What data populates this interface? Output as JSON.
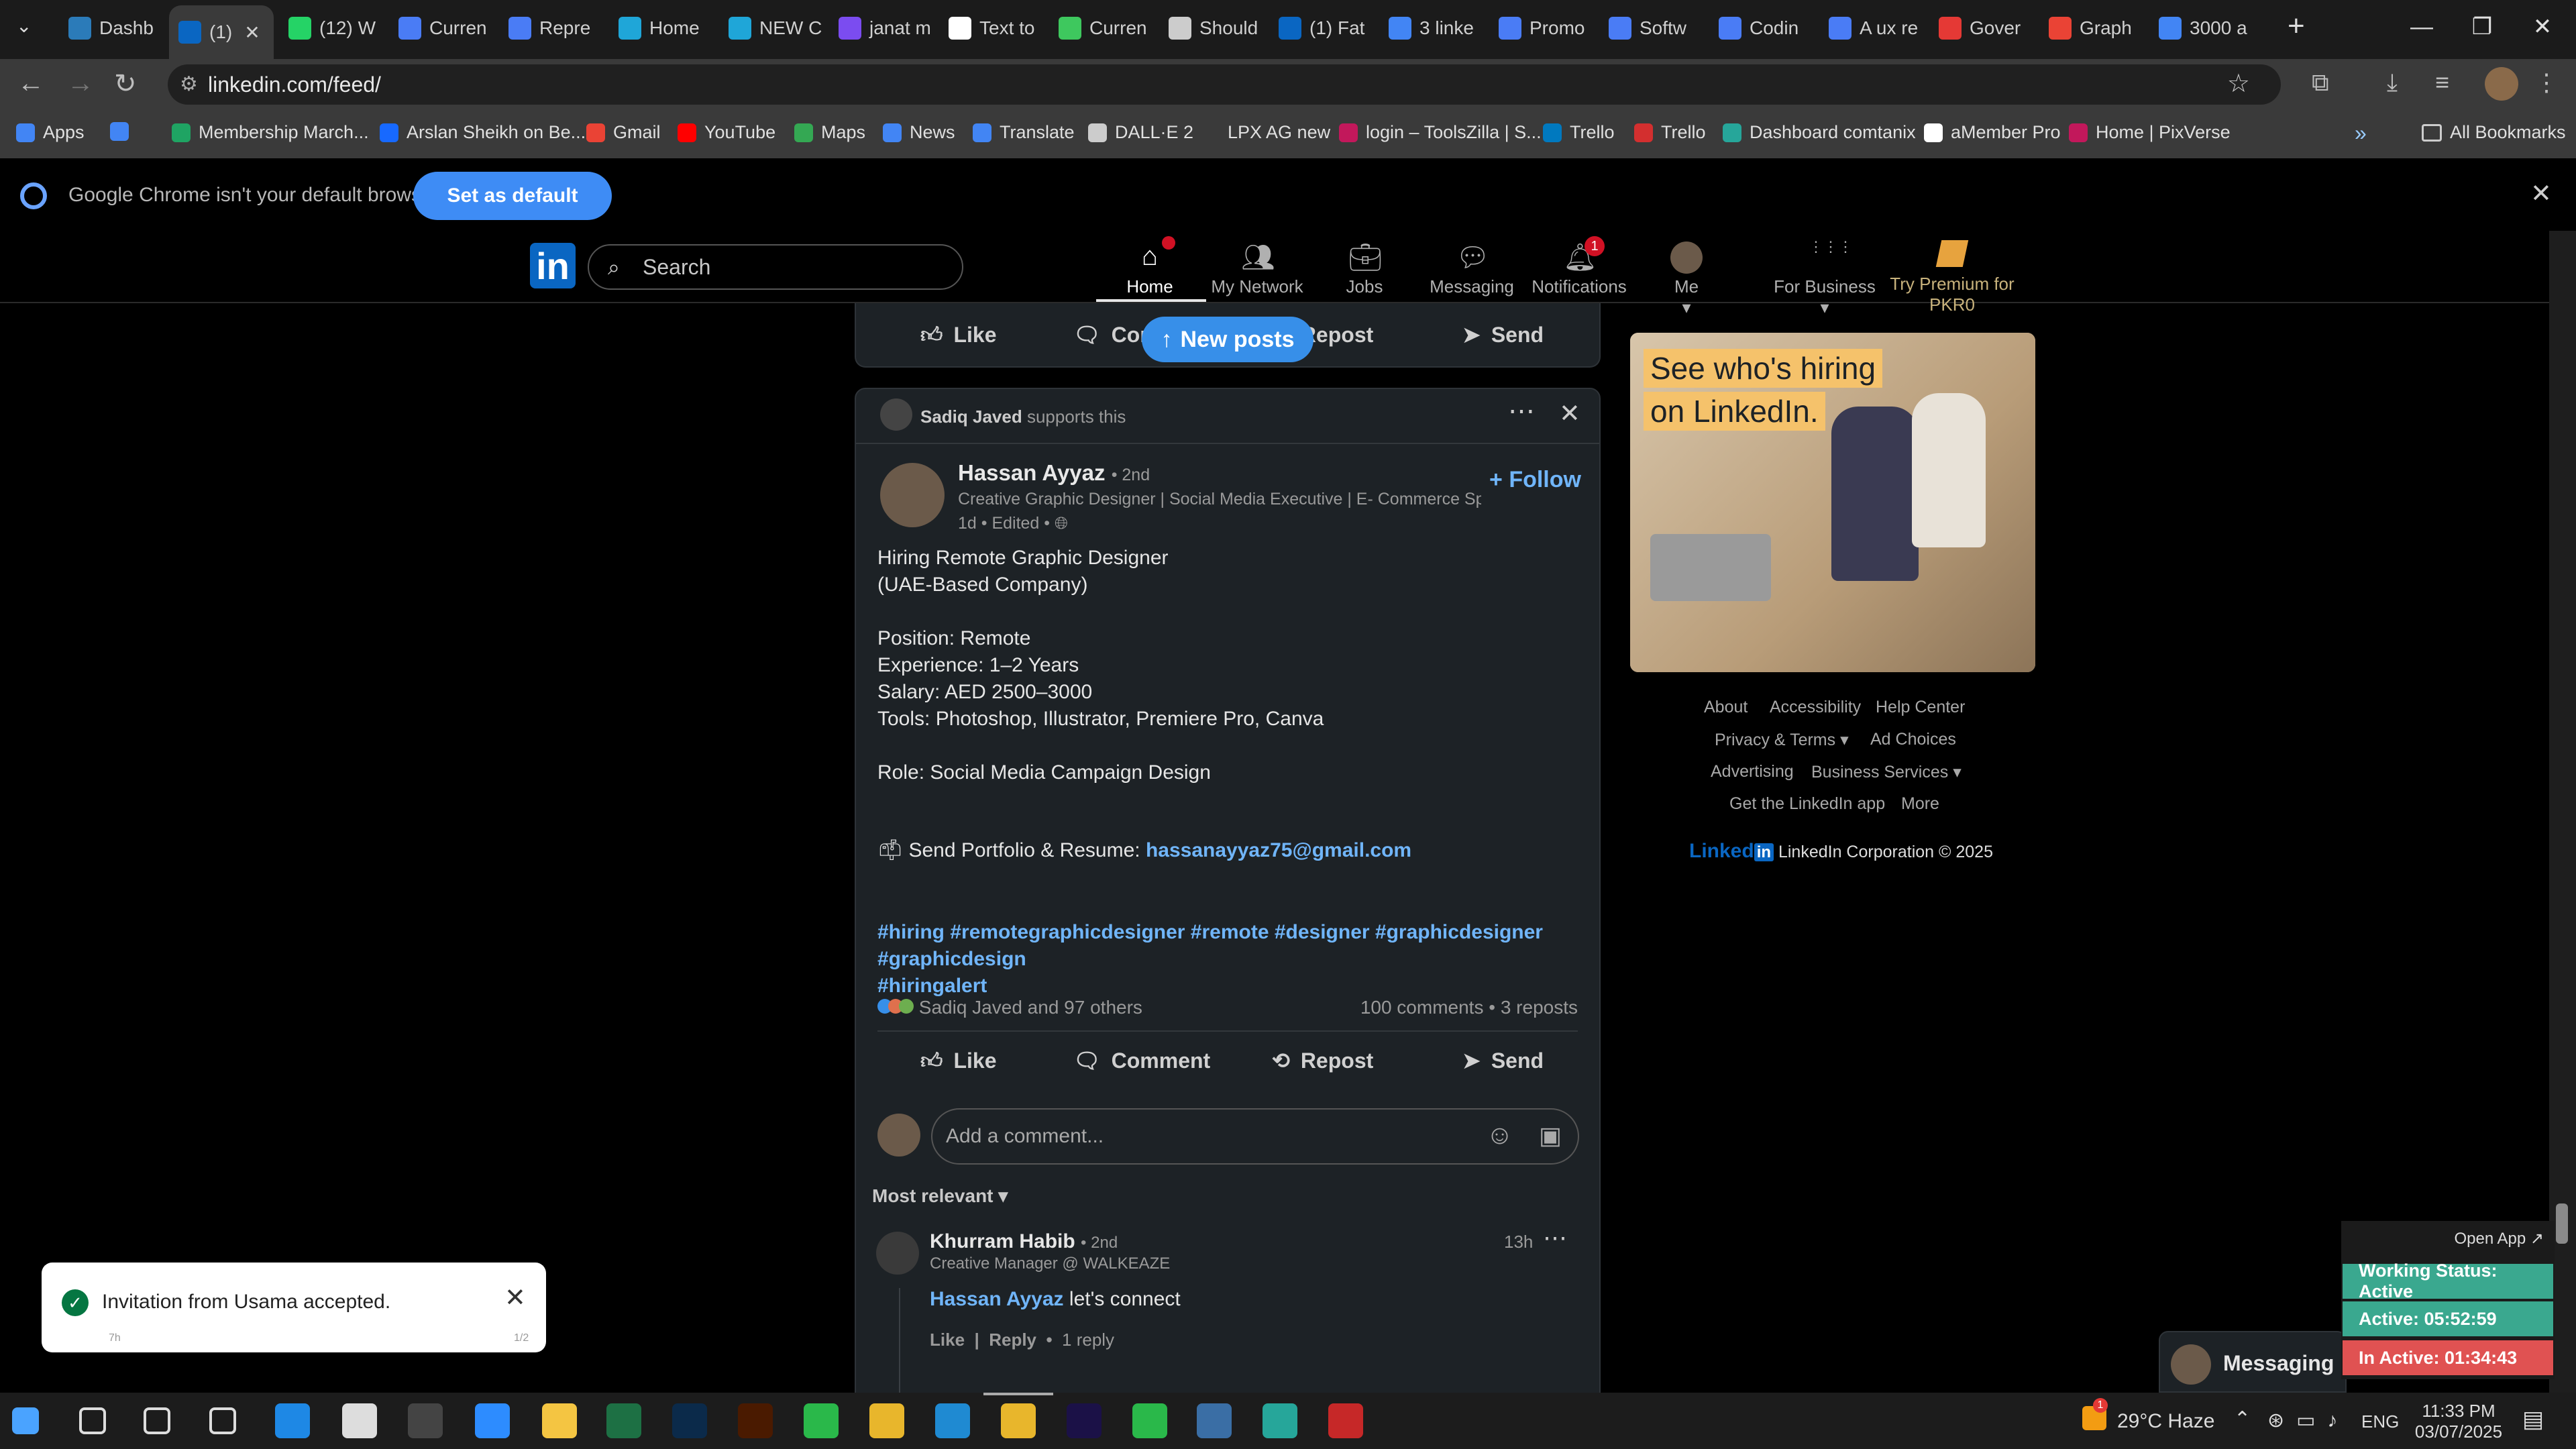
{
  "tabs": [
    {
      "label": "Dashb",
      "color": "#2b7bb9"
    },
    {
      "label": "(1)",
      "color": "#0a66c2"
    },
    {
      "label": "(12) W",
      "color": "#25d366"
    },
    {
      "label": "Curren",
      "color": "#4a7cf5"
    },
    {
      "label": "Repre",
      "color": "#4a7cf5"
    },
    {
      "label": "Home",
      "color": "#1fa6d8"
    },
    {
      "label": "NEW C",
      "color": "#1fa6d8"
    },
    {
      "label": "janat m",
      "color": "#7b4cf0"
    },
    {
      "label": "Text to",
      "color": "#ffffff"
    },
    {
      "label": "Curren",
      "color": "#3ec85e"
    },
    {
      "label": "Should",
      "color": "#cccccc"
    },
    {
      "label": "(1) Fat",
      "color": "#0a66c2"
    },
    {
      "label": "3 linke",
      "color": "#4285f4"
    },
    {
      "label": "Promo",
      "color": "#4a7cf5"
    },
    {
      "label": "Softw",
      "color": "#4a7cf5"
    },
    {
      "label": "Codin",
      "color": "#4a7cf5"
    },
    {
      "label": "A ux re",
      "color": "#4a7cf5"
    },
    {
      "label": "Gover",
      "color": "#e53935"
    },
    {
      "label": "Graph",
      "color": "#ea4335"
    },
    {
      "label": "3000 a",
      "color": "#4285f4"
    }
  ],
  "url": "linkedin.com/feed/",
  "bookmarks": [
    {
      "label": "Apps",
      "color": "#4285f4"
    },
    {
      "label": "",
      "color": "#4285f4"
    },
    {
      "label": "Membership March...",
      "color": "#1fa463"
    },
    {
      "label": "Arslan Sheikh on Be...",
      "color": "#1769ff"
    },
    {
      "label": "Gmail",
      "color": "#ea4335"
    },
    {
      "label": "YouTube",
      "color": "#ff0000"
    },
    {
      "label": "Maps",
      "color": "#34a853"
    },
    {
      "label": "News",
      "color": "#4285f4"
    },
    {
      "label": "Translate",
      "color": "#4285f4"
    },
    {
      "label": "DALL·E 2",
      "color": "#cccccc"
    },
    {
      "label": "LPX AG new",
      "color": "#3a3a3a"
    },
    {
      "label": "login – ToolsZilla | S...",
      "color": "#c2185b"
    },
    {
      "label": "Trello",
      "color": "#0079bf"
    },
    {
      "label": "Trello",
      "color": "#d32f2f"
    },
    {
      "label": "Dashboard comtanix",
      "color": "#26a69a"
    },
    {
      "label": "aMember Pro",
      "color": "#ffffff"
    },
    {
      "label": "Home | PixVerse",
      "color": "#c2185b"
    }
  ],
  "all_bookmarks": "All Bookmarks",
  "infobar": {
    "message": "Google Chrome isn't your default browser",
    "button": "Set as default"
  },
  "linkedin": {
    "search_placeholder": "Search",
    "nav": [
      {
        "label": "Home",
        "badge": "",
        "dot": true
      },
      {
        "label": "My Network",
        "badge": ""
      },
      {
        "label": "Jobs",
        "badge": ""
      },
      {
        "label": "Messaging",
        "badge": ""
      },
      {
        "label": "Notifications",
        "badge": "1"
      },
      {
        "label": "Me",
        "badge": ""
      },
      {
        "label": "For Business",
        "badge": ""
      }
    ],
    "premium": "Try Premium for PKR0"
  },
  "new_posts": "New posts",
  "actions": {
    "like": "Like",
    "comment": "Comment",
    "repost": "Repost",
    "send": "Send"
  },
  "post": {
    "supporter": "Sadiq Javed",
    "supports": "supports this",
    "author": "Hassan Ayyaz",
    "degree": "• 2nd",
    "headline": "Creative Graphic Designer | Social Media Executive | E- Commerce Spec...",
    "meta": "1d • Edited •",
    "follow": "Follow",
    "body": [
      "Hiring Remote Graphic Designer",
      "(UAE-Based Company)",
      "",
      "Position: Remote",
      "Experience: 1–2 Years",
      "Salary: AED 2500–3000",
      "Tools: Photoshop, Illustrator, Premiere Pro, Canva",
      "",
      "Role: Social Media Campaign Design"
    ],
    "portfolio_label": "Send Portfolio & Resume:",
    "email": "hassanayyaz75@gmail.com",
    "hashtags_line1": "#hiring #remotegraphicdesigner #remote #designer #graphicdesigner",
    "hashtags_line2": "#graphicdesign",
    "hashtags_line3": "#hiringalert",
    "reactions": "Sadiq Javed and 97 others",
    "stats": "100 comments • 3 reposts",
    "comment_placeholder": "Add a comment...",
    "sort": "Most relevant"
  },
  "comment": {
    "author": "Khurram Habib",
    "degree": "• 2nd",
    "headline": "Creative Manager @ WALKEAZE",
    "time": "13h",
    "mention": "Hassan Ayyaz",
    "text": "let's connect",
    "like": "Like",
    "reply": "Reply",
    "replies": "1 reply"
  },
  "ad": {
    "line1": "See who's hiring",
    "line2": "on LinkedIn."
  },
  "footer": {
    "about": "About",
    "accessibility": "Accessibility",
    "help": "Help Center",
    "privacy": "Privacy & Terms",
    "adchoices": "Ad Choices",
    "advertising": "Advertising",
    "business": "Business Services",
    "app": "Get the LinkedIn app",
    "more": "More",
    "brand": "Linked",
    "corp": "LinkedIn Corporation © 2025"
  },
  "toast": {
    "message": "Invitation from Usama accepted.",
    "left": "7h",
    "right": "1/2"
  },
  "messaging": "Messaging",
  "workstatus": {
    "open_app": "Open App ↗",
    "status": "Working Status: Active",
    "active": "Active: 05:52:59",
    "inactive": "In Active: 01:34:43"
  },
  "taskbar": {
    "weather": "29°C Haze",
    "lang": "ENG",
    "time": "11:33 PM",
    "date": "03/07/2025",
    "weather_badge": "1"
  }
}
